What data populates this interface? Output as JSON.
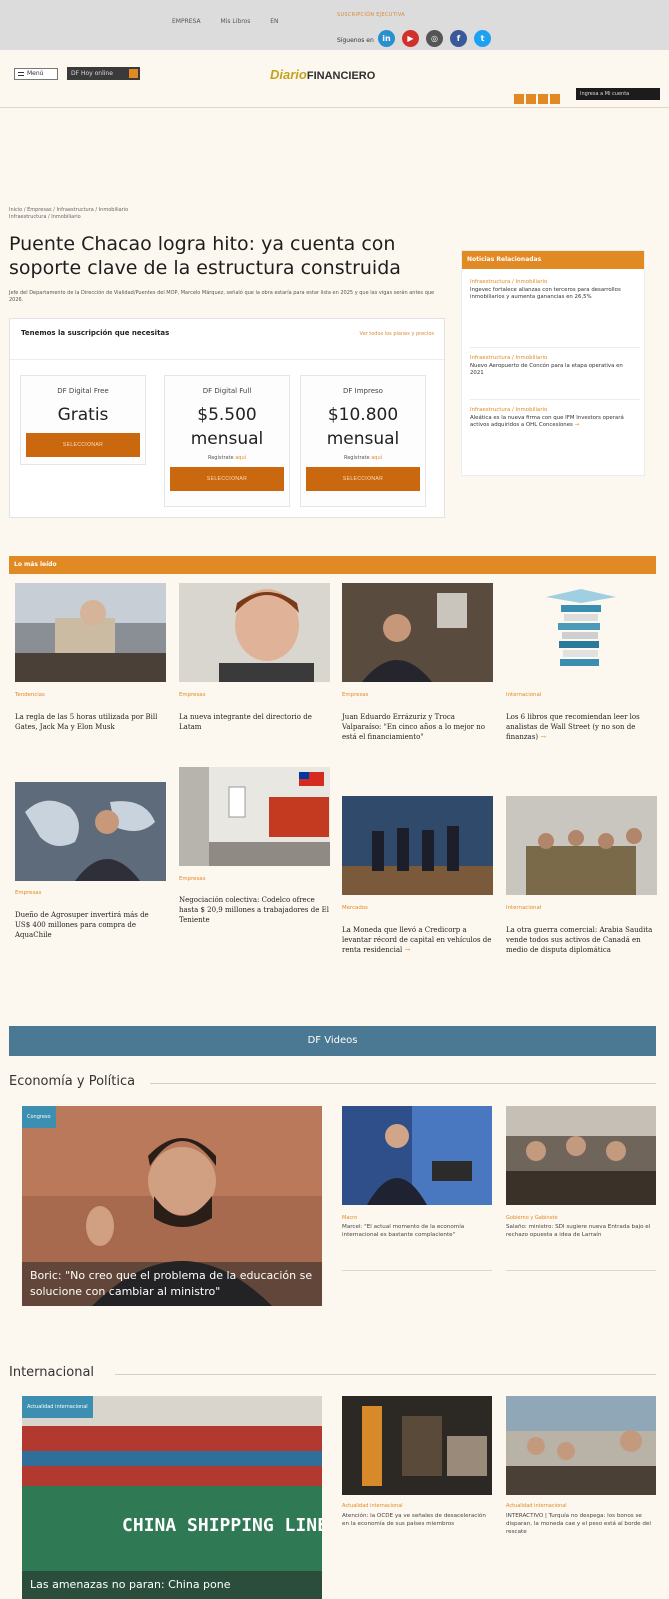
{
  "topbar": {
    "links": [
      "EMPRESA",
      "Mis Libros",
      "EN"
    ],
    "suscripcion": "SUSCRIPCIÓN EJECUTIVA",
    "siguenos": "Síguenos en"
  },
  "header": {
    "menu_label": "Menú",
    "df_hoy": "DF Hoy online",
    "logo_prefix": "Diario",
    "logo_name": "FINANCIERO",
    "ingresa": "Ingresa a Mi cuenta"
  },
  "colors": {
    "accent": "#e18a24",
    "button": "#c9680f",
    "videos_bar": "#4b7892",
    "tag_blue": "#3c8fb0"
  },
  "article": {
    "breadcrumb": "Inicio / Empresas / Infraestructura / Inmobiliario",
    "breadcrumb2": "Infraestructura / Inmobiliario",
    "title": "Puente Chacao logra hito: ya cuenta con soporte clave de la estructura construida",
    "lede": "Jefe del Departamento de la Dirección de Vialidad/Puentes del MOP, Marcelo Márquez, señaló que la obra estaría para estar lista en 2025 y que las vigas serán antes que 2026."
  },
  "subscription": {
    "heading": "Tenemos la suscripción que necesitas",
    "heading_link": "Ver todos los planes y precios",
    "registrate": "Regístrate",
    "aqui": "aquí",
    "button_label": "SELECCIONAR",
    "plans": [
      {
        "name": "DF Digital Free",
        "price": "Gratis",
        "period": ""
      },
      {
        "name": "DF Digital Full",
        "price": "$5.500",
        "period": "mensual"
      },
      {
        "name": "DF Impreso",
        "price": "$10.800",
        "period": "mensual"
      }
    ]
  },
  "related": {
    "title": "Noticias Relacionadas",
    "items": [
      {
        "cat": "Infraestructura / Inmobiliario",
        "text": "Ingevec fortalece alianzas con terceros para desarrollos inmobiliarios y aumenta ganancias en 26,5%"
      },
      {
        "cat": "Infraestructura / Inmobiliario",
        "text": "Nuevo Aeropuerto de Concón para la etapa operativa en 2021"
      },
      {
        "cat": "Infraestructura / Inmobiliario",
        "text": "Aleática es la nueva firma con que IFM Investors operará activos adquiridos a OHL Concesiones"
      }
    ]
  },
  "lo_mas_leido": {
    "title": "Lo más leído",
    "items": [
      {
        "cat": "Tendencias",
        "text": "La regla de las 5 horas utilizada por Bill Gates, Jack Ma y Elon Musk",
        "arrow": false
      },
      {
        "cat": "Empresas",
        "text": "La nueva integrante del directorio de Latam",
        "arrow": false
      },
      {
        "cat": "Empresas",
        "text": "Juan Eduardo Errázuriz y Troca Valparaíso: \"En cinco años a lo mejor no está el financiamiento\"",
        "arrow": false
      },
      {
        "cat": "Internacional",
        "text": "Los 6 libros que recomiendan leer los analistas de Wall Street (y no son de finanzas)",
        "arrow": true
      },
      {
        "cat": "Empresas",
        "text": "Dueño de Agrosuper invertirá más de US$ 400 millones para compra de AquaChile",
        "arrow": false
      },
      {
        "cat": "Empresas",
        "text": "Negociación colectiva: Codelco ofrece hasta $ 20,9 millones a trabajadores de El Teniente",
        "arrow": false
      },
      {
        "cat": "Mercados",
        "text": "La Moneda que llevó a Credicorp a levantar récord de capital en vehículos de renta residencial",
        "arrow": true
      },
      {
        "cat": "Internacional",
        "text": "La otra guerra comercial: Arabia Saudita vende todos sus activos de Canadá en medio de disputa diplomática",
        "arrow": false
      }
    ]
  },
  "videos_title": "DF Videos",
  "economia": {
    "title": "Economía y Política",
    "big_tag": "Congreso",
    "big_caption": "Boric: \"No creo que el problema de la educación se solucione con cambiar al ministro\"",
    "items": [
      {
        "cat": "Macro",
        "text": "Marcel: \"El actual momento de la economía internacional es bastante complaciente\""
      },
      {
        "cat": "Gobierno y Gabinete",
        "text": "Salaño: ministro: SDI sugiere nueva Entrada bajo el rechazo opuesta a idea de Larraín"
      }
    ]
  },
  "internacional": {
    "title": "Internacional",
    "big_tag": "Actualidad internacional",
    "big_caption": "Las amenazas no paran: China pone",
    "ship_text": "CHINA SHIPPING LINE",
    "items": [
      {
        "cat": "Actualidad internacional",
        "text": "Atención: la OCDE ya ve señales de desaceleración en la economía de sus países miembros"
      },
      {
        "cat": "Actualidad internacional",
        "text": "INTERACTIVO | Turquía no despega: los bonos se disparan, la moneda cae y el peso está al borde del rescate"
      }
    ]
  }
}
